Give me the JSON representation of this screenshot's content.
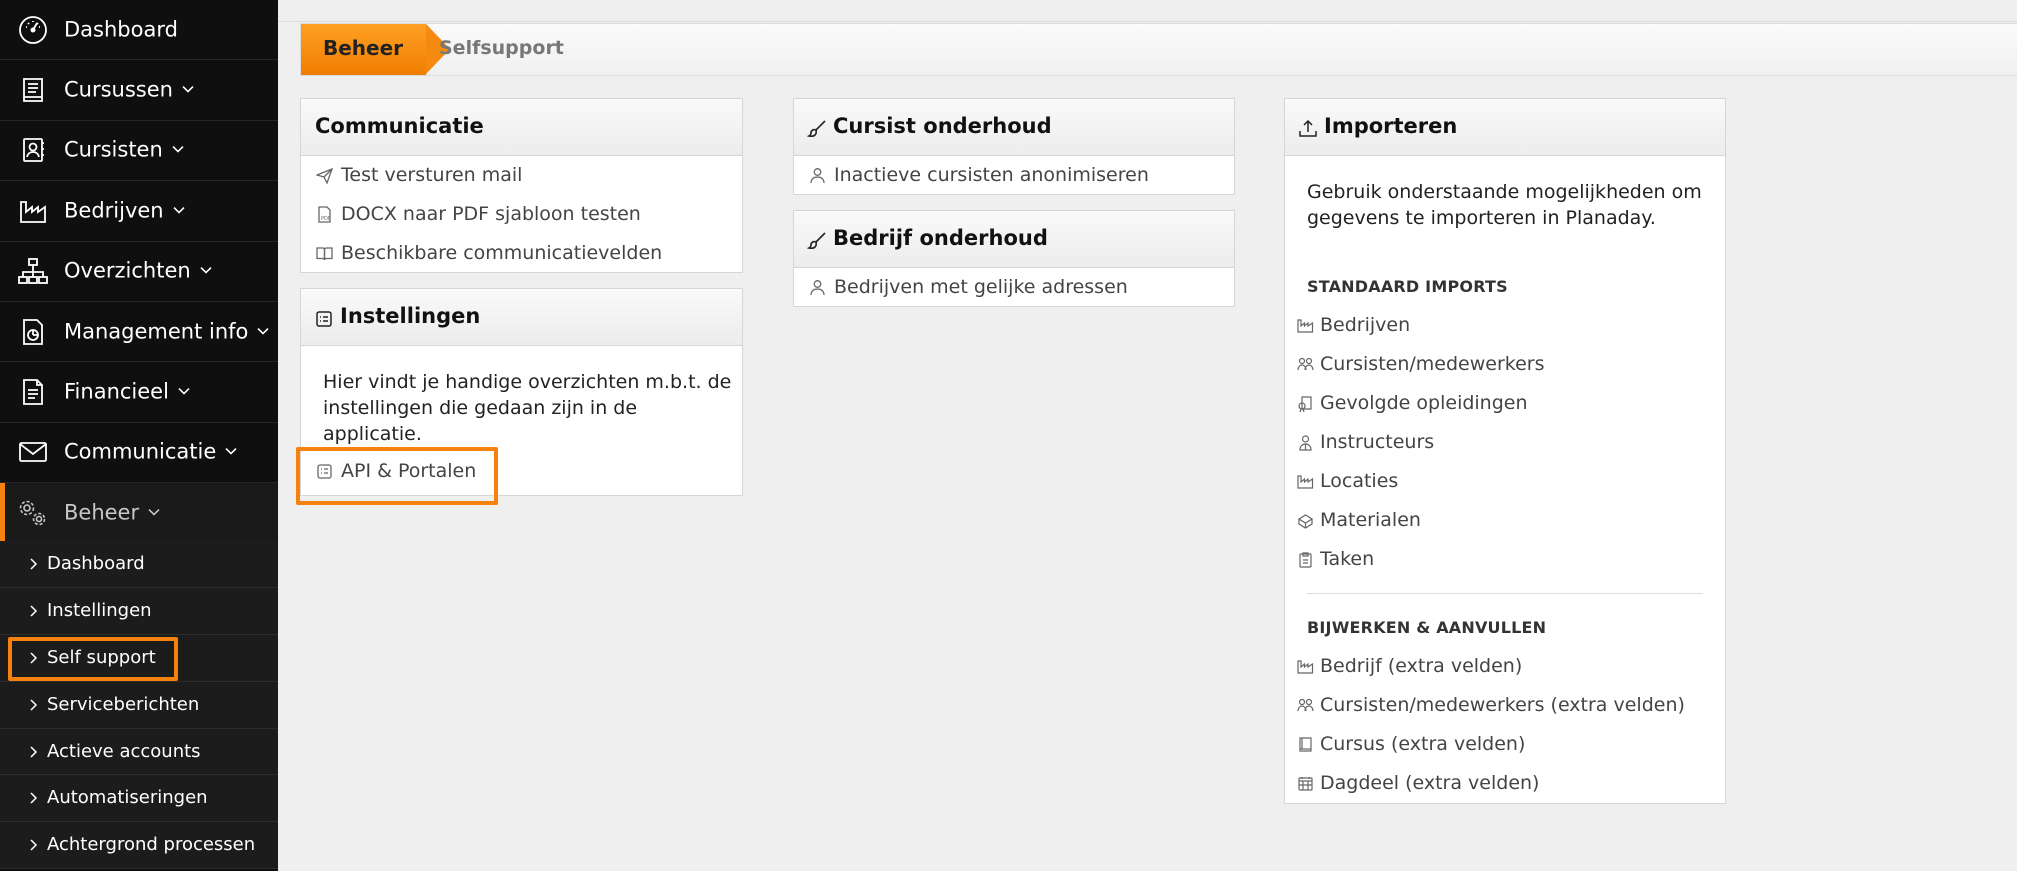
{
  "sidebar": {
    "items": [
      {
        "label": "Dashboard",
        "icon": "dashboard-icon",
        "has_dropdown": false
      },
      {
        "label": "Cursussen",
        "icon": "book-icon",
        "has_dropdown": true
      },
      {
        "label": "Cursisten",
        "icon": "contact-icon",
        "has_dropdown": true
      },
      {
        "label": "Bedrijven",
        "icon": "factory-icon",
        "has_dropdown": true
      },
      {
        "label": "Overzichten",
        "icon": "org-chart-icon",
        "has_dropdown": true
      },
      {
        "label": "Management info",
        "icon": "report-chart-icon",
        "has_dropdown": true
      },
      {
        "label": "Financieel",
        "icon": "invoice-icon",
        "has_dropdown": true
      },
      {
        "label": "Communicatie",
        "icon": "envelope-icon",
        "has_dropdown": true
      },
      {
        "label": "Beheer",
        "icon": "gears-icon",
        "has_dropdown": true,
        "active": true
      }
    ],
    "subitems": [
      {
        "label": "Dashboard"
      },
      {
        "label": "Instellingen"
      },
      {
        "label": "Self support",
        "highlighted": true
      },
      {
        "label": "Serviceberichten"
      },
      {
        "label": "Actieve accounts"
      },
      {
        "label": "Automatiseringen"
      },
      {
        "label": "Achtergrond processen"
      }
    ]
  },
  "breadcrumb": {
    "current_section": "Beheer",
    "page": "Selfsupport"
  },
  "panels": {
    "communicatie": {
      "title": "Communicatie",
      "links": [
        {
          "label": "Test versturen mail",
          "icon": "paper-plane-icon"
        },
        {
          "label": "DOCX naar PDF sjabloon testen",
          "icon": "pdf-file-icon"
        },
        {
          "label": "Beschikbare communicatievelden",
          "icon": "open-book-icon"
        }
      ]
    },
    "instellingen": {
      "title": "Instellingen",
      "description": "Hier vindt je handige overzichten m.b.t. de instellingen die gedaan zijn in de applicatie.",
      "links": [
        {
          "label": "API & Portalen",
          "icon": "settings-list-icon",
          "highlighted": true
        }
      ]
    },
    "cursist_onderhoud": {
      "title": "Cursist onderhoud",
      "links": [
        {
          "label": "Inactieve cursisten anonimiseren",
          "icon": "user-icon"
        }
      ]
    },
    "bedrijf_onderhoud": {
      "title": "Bedrijf onderhoud",
      "links": [
        {
          "label": "Bedrijven met gelijke adressen",
          "icon": "user-icon"
        }
      ]
    },
    "importeren": {
      "title": "Importeren",
      "description": "Gebruik onderstaande mogelijkheden om gegevens te importeren in Planaday.",
      "standaard_title": "STANDAARD IMPORTS",
      "standaard_links": [
        {
          "label": "Bedrijven",
          "icon": "factory-icon"
        },
        {
          "label": "Cursisten/medewerkers",
          "icon": "users-icon"
        },
        {
          "label": "Gevolgde opleidingen",
          "icon": "certificate-icon"
        },
        {
          "label": "Instructeurs",
          "icon": "instructor-icon"
        },
        {
          "label": "Locaties",
          "icon": "factory-icon"
        },
        {
          "label": "Materialen",
          "icon": "boxes-icon"
        },
        {
          "label": "Taken",
          "icon": "clipboard-icon"
        }
      ],
      "bijwerken_title": "BIJWERKEN & AANVULLEN",
      "bijwerken_links": [
        {
          "label": "Bedrijf (extra velden)",
          "icon": "factory-icon"
        },
        {
          "label": "Cursisten/medewerkers (extra velden)",
          "icon": "users-icon"
        },
        {
          "label": "Cursus (extra velden)",
          "icon": "book-icon"
        },
        {
          "label": "Dagdeel (extra velden)",
          "icon": "calendar-icon"
        }
      ]
    }
  },
  "colors": {
    "accent": "#f5820f",
    "sidebar_bg": "#0f0f0f",
    "subnav_bg": "#1c1c1c",
    "page_bg": "#efefef"
  }
}
